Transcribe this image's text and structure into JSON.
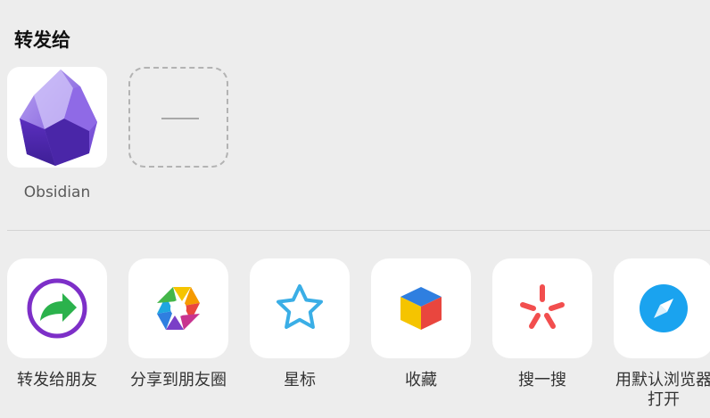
{
  "section_title": "转发给",
  "share_targets": [
    {
      "label": "Obsidian",
      "icon": "obsidian-logo-icon"
    },
    {
      "label": "",
      "icon": "add-more-placeholder-icon"
    }
  ],
  "actions": [
    {
      "label": "转发给朋友",
      "icon": "forward-to-friend-icon"
    },
    {
      "label": "分享到朋友圈",
      "icon": "moments-icon"
    },
    {
      "label": "星标",
      "icon": "star-icon"
    },
    {
      "label": "收藏",
      "icon": "favorites-cube-icon"
    },
    {
      "label": "搜一搜",
      "icon": "search-sparkle-icon"
    },
    {
      "label": "用默认浏览器打开",
      "icon": "compass-icon"
    }
  ],
  "colors": {
    "background": "#ededed",
    "tile": "#ffffff",
    "forward_ring": "#7d2fc8",
    "forward_arrow": "#2bb24c",
    "star": "#3aaee6",
    "compass": "#1aa3ef",
    "search": "#f24e4e",
    "obsidian": "#7c4ddb"
  }
}
